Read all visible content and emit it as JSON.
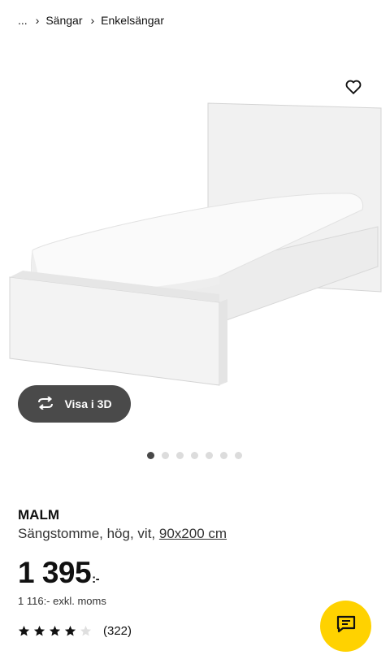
{
  "breadcrumb": {
    "ellipsis": "...",
    "items": [
      "Sängar",
      "Enkelsängar"
    ]
  },
  "icons": {
    "favorite": "heart-outline-icon",
    "view3d": "rotate-arrows-icon",
    "chat": "chat-bubble-icon",
    "rating": "star-icon"
  },
  "gallery": {
    "view3d_label": "Visa i 3D",
    "dots_total": 7,
    "active_index": 0
  },
  "product": {
    "name": "MALM",
    "description": "Sängstomme, hög, vit,",
    "size_link": "90x200 cm",
    "price": "1 395",
    "price_suffix": ":-",
    "price_excl_vat": "1 116:- exkl. moms",
    "rating": 4,
    "rating_max": 5,
    "review_count": "(322)"
  },
  "colors": {
    "chat_button": "#ffd200",
    "view3d_button": "#4a4a4a",
    "active_dot": "#484848"
  }
}
